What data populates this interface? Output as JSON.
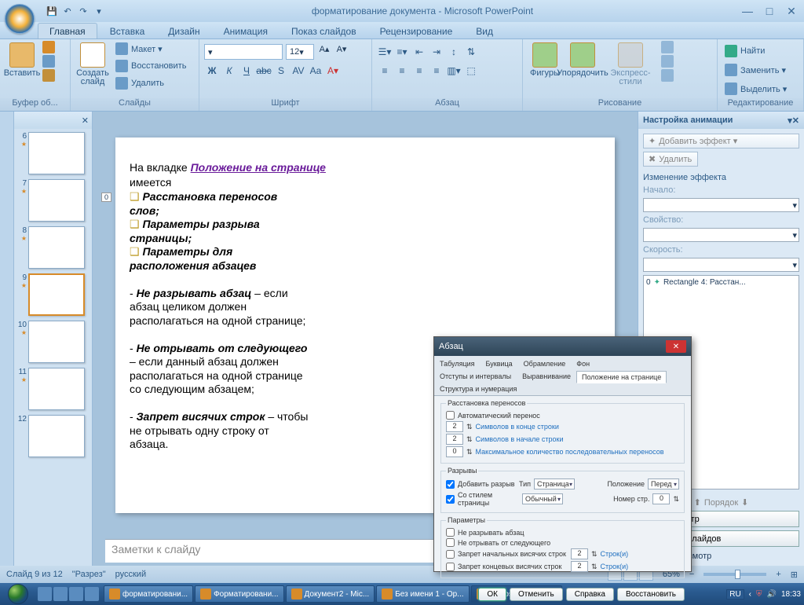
{
  "titlebar": {
    "title": "форматирование документа - Microsoft PowerPoint"
  },
  "tabs": [
    "Главная",
    "Вставка",
    "Дизайн",
    "Анимация",
    "Показ слайдов",
    "Рецензирование",
    "Вид"
  ],
  "activeTab": 0,
  "ribbon": {
    "clipboard": {
      "label": "Буфер об...",
      "paste": "Вставить"
    },
    "slides": {
      "label": "Слайды",
      "new": "Создать\nслайд",
      "layout": "Макет ▾",
      "reset": "Восстановить",
      "delete": "Удалить"
    },
    "font": {
      "label": "Шрифт",
      "size": "12",
      "btns1": [
        "Ж",
        "К",
        "Ч",
        "abc",
        "S",
        "AV",
        "Aa"
      ]
    },
    "para": {
      "label": "Абзац"
    },
    "draw": {
      "label": "Рисование",
      "shapes": "Фигуры",
      "arrange": "Упорядочить",
      "styles": "Экспресс-стили"
    },
    "edit": {
      "label": "Редактирование",
      "find": "Найти",
      "replace": "Заменить ▾",
      "select": "Выделить ▾"
    }
  },
  "thumbs": [
    {
      "n": "6",
      "star": true
    },
    {
      "n": "7",
      "star": true
    },
    {
      "n": "8",
      "star": true
    },
    {
      "n": "9",
      "star": true,
      "sel": true
    },
    {
      "n": "10",
      "star": true
    },
    {
      "n": "11",
      "star": true
    },
    {
      "n": "12",
      "star": false
    }
  ],
  "slide": {
    "tag": "0",
    "line1a": "На вкладке  ",
    "line1b": "Положение на странице",
    "line2": "имеется",
    "b1": "Расстановка переносов слов;",
    "b2": "Параметры разрыва страницы;",
    "b3": "Параметры для расположения абзацев",
    "p1a": "Не  разрывать абзац",
    "p1b": " – если абзац целиком должен располагаться на одной странице;",
    "p2a": "Не отрывать от следующего",
    "p2b": " – если  данный абзац должен располагаться на одной странице со следующим абзацем;",
    "p3a": "Запрет висячих строк",
    "p3b": " – чтобы не отрывать одну строку от абзаца."
  },
  "dialog": {
    "title": "Абзац",
    "tabs_row1": [
      "Табуляция",
      "Буквица",
      "Обрамление",
      "Фон"
    ],
    "tabs_row2": [
      "Отступы и интервалы",
      "Выравнивание",
      "Положение на странице",
      "Структура и нумерация"
    ],
    "activeTab": "Положение на странице",
    "fs1": {
      "legend": "Расстановка переносов",
      "auto": "Автоматический перенос",
      "r1": "Символов в конце строки",
      "r2": "Символов в начале строки",
      "r3": "Максимальное количество последовательных переносов",
      "v1": "2",
      "v2": "2",
      "v3": "0"
    },
    "fs2": {
      "legend": "Разрывы",
      "add": "Добавить разрыв",
      "withstyle": "Со стилем страницы",
      "typeLbl": "Тип",
      "typeVal": "Страница",
      "styleVal": "Обычный",
      "posLbl": "Положение",
      "posVal": "Перед",
      "pageLbl": "Номер стр.",
      "pageVal": "0"
    },
    "fs3": {
      "legend": "Параметры",
      "c1": "Не разрывать абзац",
      "c2": "Не отрывать от следующего",
      "c3": "Запрет начальных висячих строк",
      "c4": "Запрет концевых висячих строк",
      "v": "2",
      "unit": "Строк(и)"
    },
    "btns": {
      "ok": "ОК",
      "cancel": "Отменить",
      "help": "Справка",
      "reset": "Восстановить"
    }
  },
  "notes": "Заметки к слайду",
  "anim": {
    "title": "Настройка анимации",
    "addEffect": "Добавить эффект ▾",
    "remove": "Удалить",
    "changeHdr": "Изменение эффекта",
    "start": "Начало:",
    "prop": "Свойство:",
    "speed": "Скорость:",
    "item": {
      "n": "0",
      "name": "Rectangle 4:  Расстан..."
    },
    "order": "Порядок",
    "play": "Просмотр",
    "show": "Показ слайдов",
    "auto": "Автопросмотр"
  },
  "status": {
    "slide": "Слайд 9 из 12",
    "theme": "\"Разрез\"",
    "lang": "русский",
    "zoom": "65%"
  },
  "taskbar": {
    "items": [
      {
        "t": "форматировани...",
        "a": false
      },
      {
        "t": "Форматировани...",
        "a": false
      },
      {
        "t": "Документ2 - Mic...",
        "a": false
      },
      {
        "t": "Без имени 1 - Op...",
        "a": false
      },
      {
        "t": "Microsoft PowerP...",
        "a": true
      }
    ],
    "lang": "RU",
    "time": "18:33"
  }
}
